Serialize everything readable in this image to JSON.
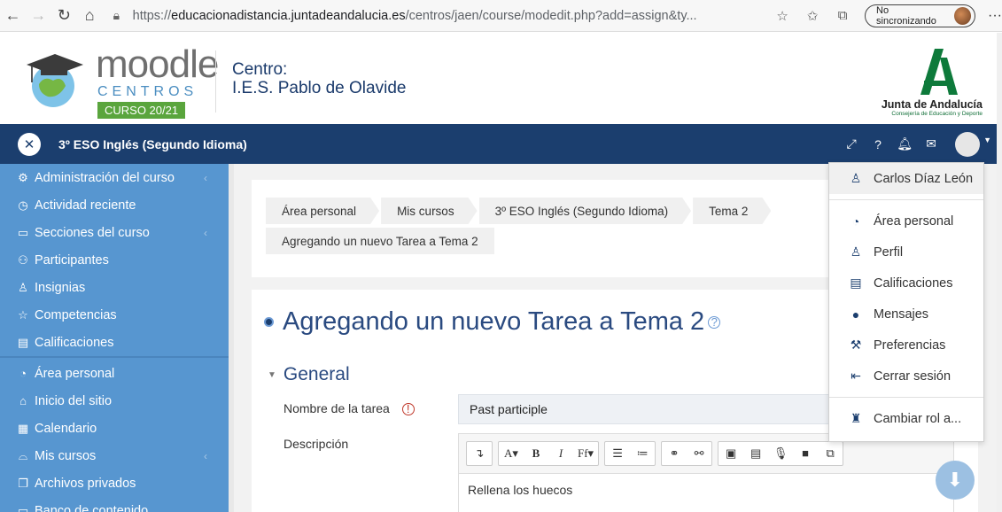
{
  "browser": {
    "url_prefix": "https://",
    "url_host": "educacionadistancia.juntadeandalucia.es",
    "url_path": "/centros/jaen/course/modedit.php?add=assign&ty...",
    "sync_label": "No sincronizando",
    "more": "···"
  },
  "header": {
    "moodle": "moodle",
    "centros": "CENTROS",
    "curso": "CURSO 20/21",
    "centro_label": "Centro:",
    "centro_name": "I.E.S. Pablo de Olavide",
    "junta_name": "Junta de Andalucía",
    "junta_sub": "Consejería de Educación y Deporte"
  },
  "navbar": {
    "course_title": "3º ESO Inglés (Segundo Idioma)"
  },
  "sidebar": {
    "items": [
      {
        "label": "Administración del curso",
        "icon": "gears-icon",
        "chevron": true
      },
      {
        "label": "Actividad reciente",
        "icon": "clock-icon",
        "chevron": false
      },
      {
        "label": "Secciones del curso",
        "icon": "folder-icon",
        "chevron": true
      },
      {
        "label": "Participantes",
        "icon": "users-icon",
        "chevron": false
      },
      {
        "label": "Insignias",
        "icon": "badge-icon",
        "chevron": false
      },
      {
        "label": "Competencias",
        "icon": "star-icon",
        "chevron": false
      },
      {
        "label": "Calificaciones",
        "icon": "grades-icon",
        "chevron": false
      },
      {
        "label": "Área personal",
        "icon": "dashboard-icon",
        "chevron": false
      },
      {
        "label": "Inicio del sitio",
        "icon": "home-icon",
        "chevron": false
      },
      {
        "label": "Calendario",
        "icon": "calendar-icon",
        "chevron": false
      },
      {
        "label": "Mis cursos",
        "icon": "graduation-cap-icon",
        "chevron": true
      },
      {
        "label": "Archivos privados",
        "icon": "files-icon",
        "chevron": false
      },
      {
        "label": "Banco de contenido",
        "icon": "content-bank-icon",
        "chevron": false
      }
    ]
  },
  "breadcrumb": [
    "Área personal",
    "Mis cursos",
    "3º ESO Inglés (Segundo Idioma)",
    "Tema 2",
    "Agregando un nuevo Tarea a Tema 2"
  ],
  "main": {
    "title": "Agregando un nuevo Tarea a Tema 2",
    "section": "General",
    "name_label": "Nombre de la tarea",
    "name_value": "Past participle",
    "desc_label": "Descripción",
    "editor_text": "Rellena los huecos"
  },
  "dropdown": {
    "items": [
      {
        "label": "Carlos Díaz León",
        "icon": "user-icon"
      },
      {
        "label": "Área personal",
        "icon": "dashboard-icon"
      },
      {
        "label": "Perfil",
        "icon": "user-icon"
      },
      {
        "label": "Calificaciones",
        "icon": "grades-icon"
      },
      {
        "label": "Mensajes",
        "icon": "message-icon"
      },
      {
        "label": "Preferencias",
        "icon": "wrench-icon"
      },
      {
        "label": "Cerrar sesión",
        "icon": "logout-icon"
      },
      {
        "label": "Cambiar rol a...",
        "icon": "role-icon"
      }
    ]
  }
}
